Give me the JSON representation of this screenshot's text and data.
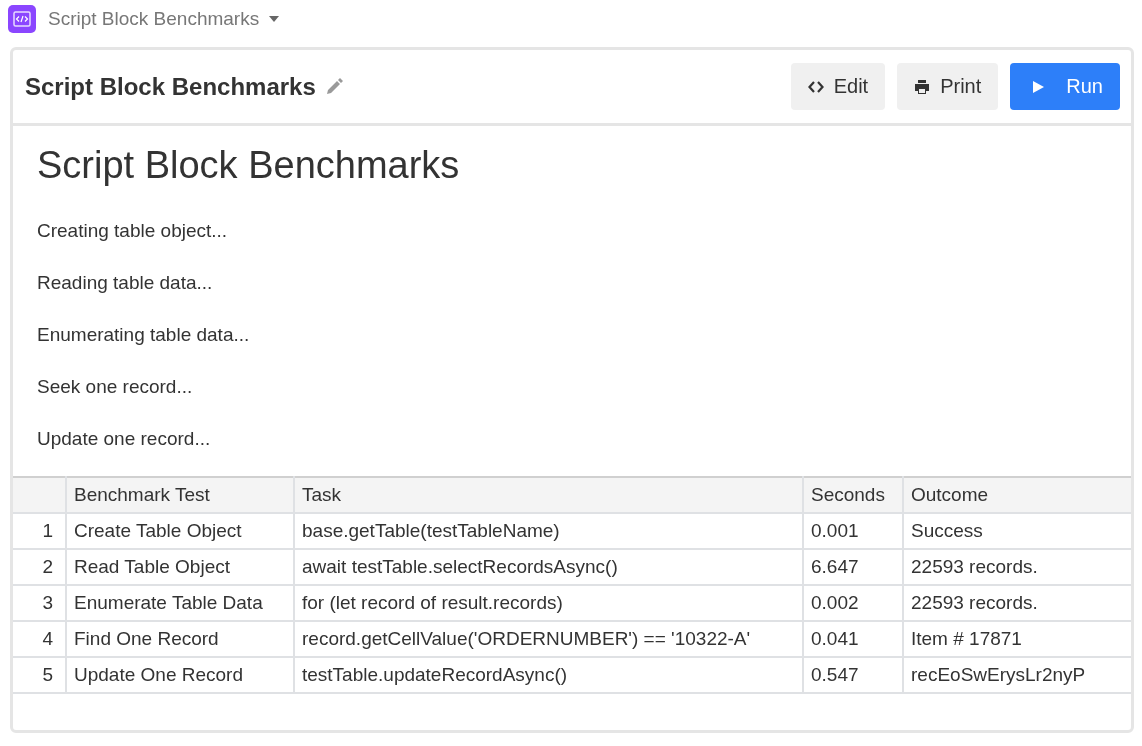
{
  "app_bar": {
    "title": "Script Block Benchmarks"
  },
  "panel": {
    "title": "Script Block Benchmarks",
    "buttons": [
      {
        "label": "Edit",
        "kind": "edit"
      },
      {
        "label": "Print",
        "kind": "print"
      },
      {
        "label": "Run",
        "kind": "run"
      }
    ]
  },
  "output": {
    "heading": "Script Block Benchmarks",
    "log": [
      "Creating table object...",
      "Reading table data...",
      "Enumerating table data...",
      "Seek one record...",
      "Update one record..."
    ],
    "table": {
      "columns": [
        "Benchmark Test",
        "Task",
        "Seconds",
        "Outcome"
      ],
      "rows": [
        {
          "index": "1",
          "cells": [
            "Create Table Object",
            "base.getTable(testTableName)",
            "0.001",
            "Success"
          ]
        },
        {
          "index": "2",
          "cells": [
            "Read Table Object",
            "await testTable.selectRecordsAsync()",
            "6.647",
            "22593 records."
          ]
        },
        {
          "index": "3",
          "cells": [
            "Enumerate Table Data",
            "for (let record of result.records)",
            "0.002",
            "22593 records."
          ]
        },
        {
          "index": "4",
          "cells": [
            "Find One Record",
            "record.getCellValue('ORDERNUMBER') == '10322-A'",
            "0.041",
            "Item # 17871"
          ]
        },
        {
          "index": "5",
          "cells": [
            "Update One Record",
            "testTable.updateRecordAsync()",
            "0.547",
            "recEoSwErysLr2nyP"
          ]
        }
      ]
    }
  }
}
